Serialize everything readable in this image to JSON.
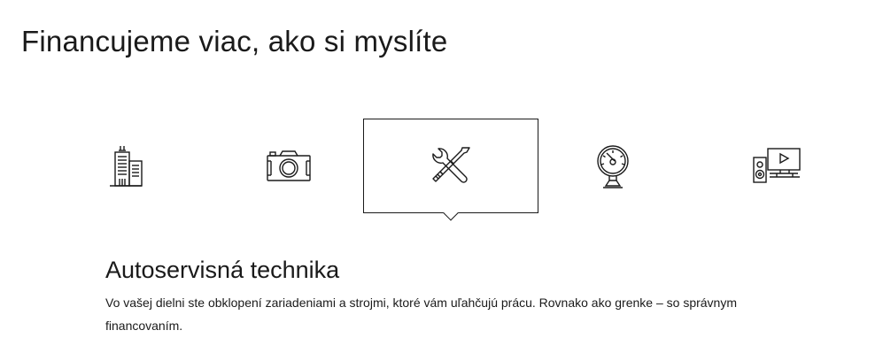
{
  "page": {
    "title": "Financujeme viac, ako si myslíte"
  },
  "categories": [
    {
      "icon": "building-icon",
      "selected": false
    },
    {
      "icon": "camera-icon",
      "selected": false
    },
    {
      "icon": "tools-icon",
      "selected": true
    },
    {
      "icon": "gauge-icon",
      "selected": false
    },
    {
      "icon": "media-devices-icon",
      "selected": false
    }
  ],
  "detail": {
    "title": "Autoservisná technika",
    "description": "Vo vašej dielni ste obklopení zariadeniami a strojmi, ktoré vám uľahčujú prácu. Rovnako ako grenke – so správnym financovaním."
  },
  "colors": {
    "text": "#1a1a1a",
    "background": "#ffffff"
  }
}
